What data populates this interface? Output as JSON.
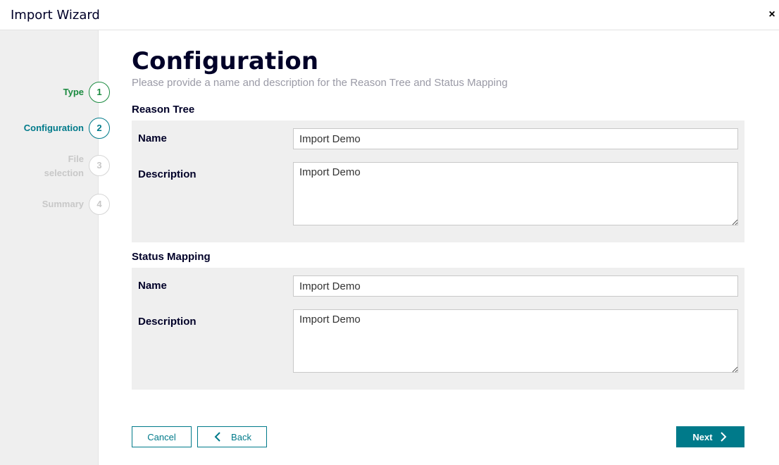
{
  "window": {
    "title": "Import Wizard",
    "close_glyph": "×"
  },
  "steps": [
    {
      "label": "Type",
      "number": "1",
      "state": "done"
    },
    {
      "label": "Configuration",
      "number": "2",
      "state": "active"
    },
    {
      "label": "File selection",
      "number": "3",
      "state": "pending"
    },
    {
      "label": "Summary",
      "number": "4",
      "state": "pending"
    }
  ],
  "page": {
    "title": "Configuration",
    "subtitle": "Please provide a name and description for the Reason Tree and Status Mapping"
  },
  "reason_tree": {
    "heading": "Reason Tree",
    "name_label": "Name",
    "name_value": "Import Demo",
    "description_label": "Description",
    "description_value": "Import Demo"
  },
  "status_mapping": {
    "heading": "Status Mapping",
    "name_label": "Name",
    "name_value": "Import Demo",
    "description_label": "Description",
    "description_value": "Import Demo"
  },
  "footer": {
    "cancel_label": "Cancel",
    "back_label": "Back",
    "next_label": "Next"
  },
  "colors": {
    "accent": "#007a8a",
    "done": "#1a8a3f",
    "pending": "#c8c8c8",
    "text": "#000028"
  }
}
